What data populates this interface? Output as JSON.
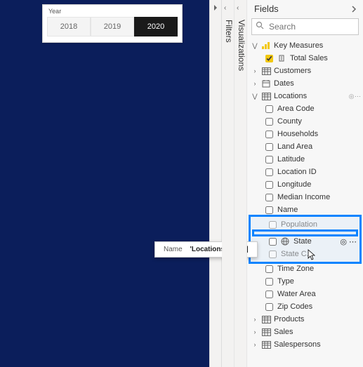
{
  "canvas": {
    "slicer_title": "Year",
    "years": [
      "2018",
      "2019",
      "2020"
    ],
    "active_year_index": 2
  },
  "tooltip": {
    "label": "Name",
    "value": "'Locations'[State]"
  },
  "rails": {
    "filters": "Filters",
    "visualizations": "Visualizations"
  },
  "fields": {
    "title": "Fields",
    "search_placeholder": "Search",
    "tables": [
      {
        "name": "Key Measures",
        "expanded": true,
        "icon": "measure-group",
        "fields": [
          {
            "name": "Total Sales",
            "checked": true,
            "icon": "measure"
          }
        ]
      },
      {
        "name": "Customers",
        "expanded": false,
        "icon": "table",
        "fields": []
      },
      {
        "name": "Dates",
        "expanded": false,
        "icon": "date",
        "fields": []
      },
      {
        "name": "Locations",
        "expanded": true,
        "icon": "table",
        "reveal": true,
        "fields": [
          {
            "name": "Area Code"
          },
          {
            "name": "County"
          },
          {
            "name": "Households"
          },
          {
            "name": "Land Area"
          },
          {
            "name": "Latitude"
          },
          {
            "name": "Location ID"
          },
          {
            "name": "Longitude"
          },
          {
            "name": "Median Income"
          },
          {
            "name": "Name"
          },
          {
            "name": "Population",
            "dim": true
          },
          {
            "name": "State",
            "icon": "globe",
            "highlight": true,
            "reveal": true
          },
          {
            "name": "State C...",
            "dim": true
          },
          {
            "name": "Time Zone"
          },
          {
            "name": "Type"
          },
          {
            "name": "Water Area"
          },
          {
            "name": "Zip Codes"
          }
        ]
      },
      {
        "name": "Products",
        "expanded": false,
        "icon": "table",
        "fields": []
      },
      {
        "name": "Sales",
        "expanded": false,
        "icon": "table",
        "fields": []
      },
      {
        "name": "Salespersons",
        "expanded": false,
        "icon": "table",
        "fields": []
      }
    ]
  }
}
